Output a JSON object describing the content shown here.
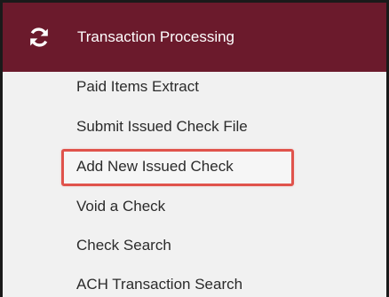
{
  "menu": {
    "header": {
      "icon": "refresh-icon",
      "title": "Transaction Processing",
      "background": "#6b1a2c"
    },
    "items": [
      {
        "label": "Paid Items Extract"
      },
      {
        "label": "Submit Issued Check File"
      },
      {
        "label": "Add New Issued Check",
        "highlighted": true
      },
      {
        "label": "Void a Check"
      },
      {
        "label": "Check Search"
      },
      {
        "label": "ACH Transaction Search"
      }
    ],
    "highlight_color": "#e0534c"
  }
}
